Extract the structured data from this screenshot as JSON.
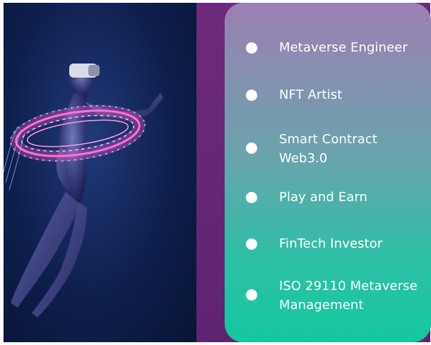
{
  "list": {
    "items": [
      {
        "label": "Metaverse Engineer"
      },
      {
        "label": "NFT Artist"
      },
      {
        "label": "Smart Contract Web3.0"
      },
      {
        "label": "Play and Earn"
      },
      {
        "label": "FinTech Investor"
      },
      {
        "label": "ISO 29110 Metaverse Management"
      }
    ]
  },
  "colors": {
    "photo_background": "#0e1f4d",
    "purple_band": "#6a2a78",
    "card_top": "#9d7fb3",
    "card_bottom": "#13c8a0",
    "neon_ring": "#ff4fc8",
    "text": "#ffffff"
  },
  "icons": [
    "bullet-dot-icon",
    "vr-headset-icon"
  ]
}
